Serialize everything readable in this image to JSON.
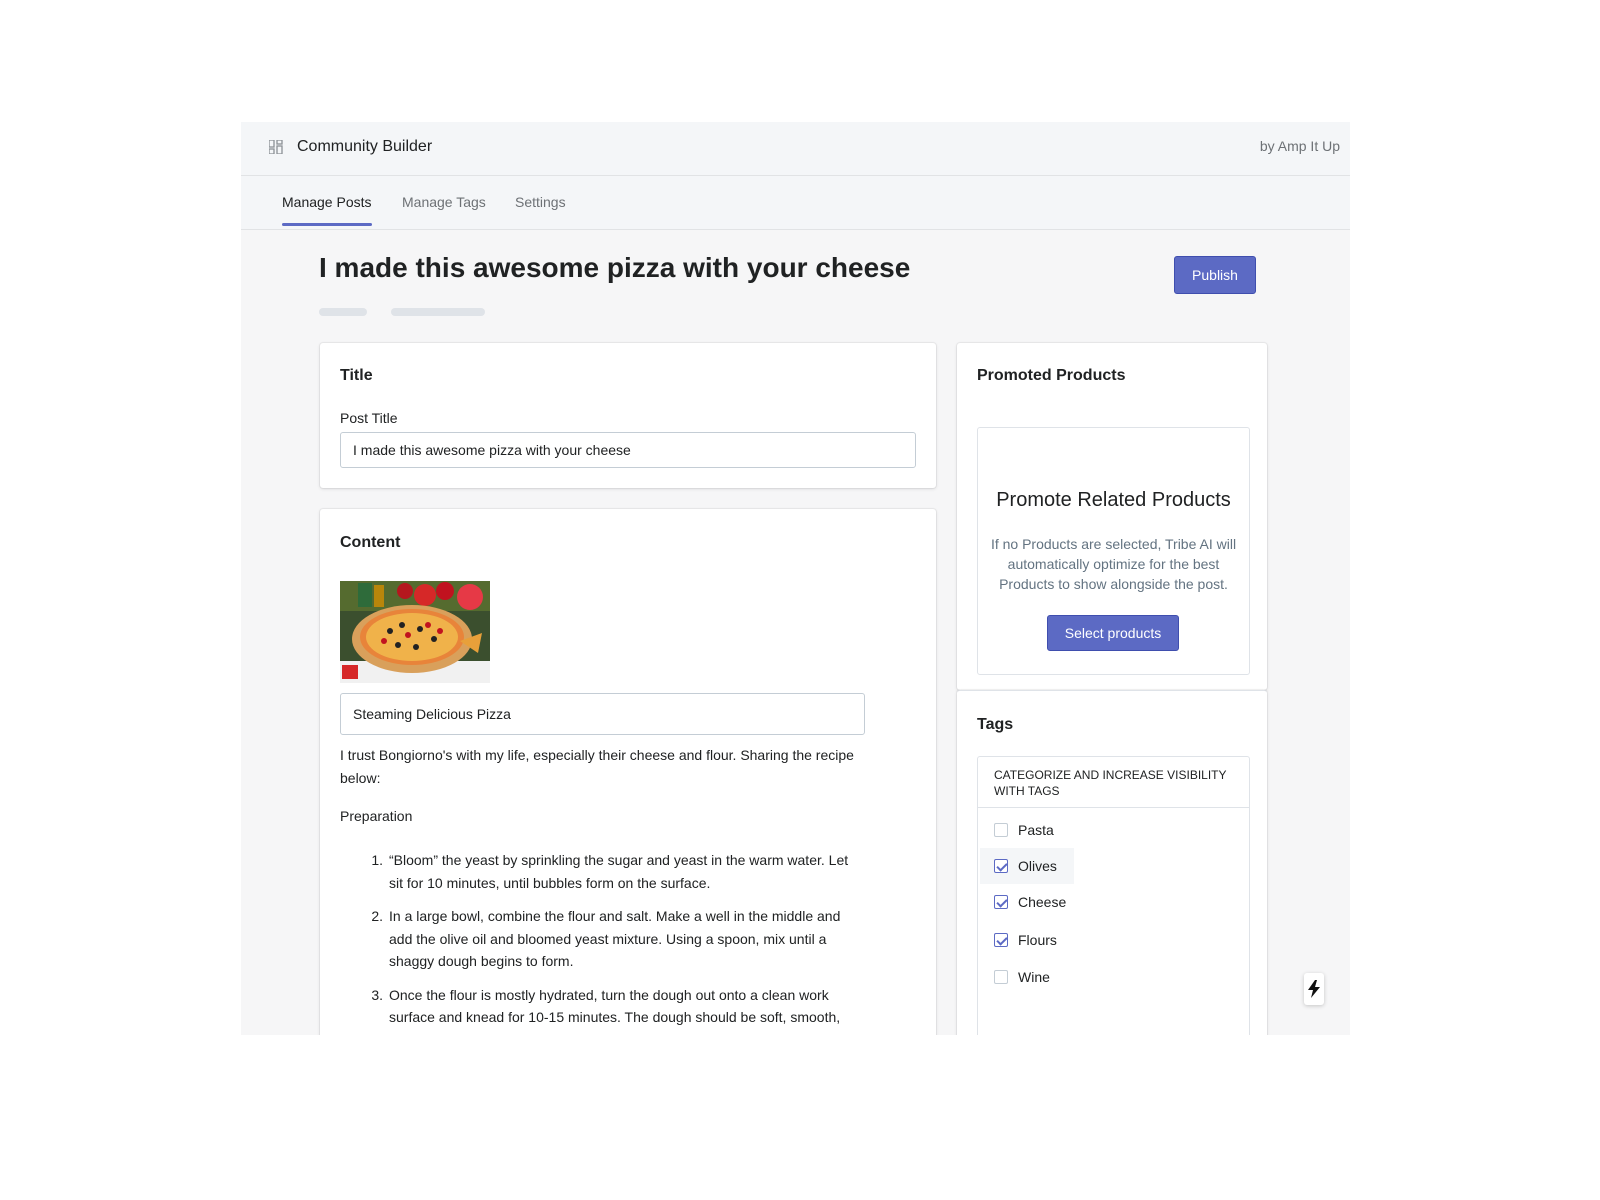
{
  "header": {
    "app_title": "Community Builder",
    "byline": "by Amp It Up"
  },
  "tabs": [
    {
      "label": "Manage Posts"
    },
    {
      "label": "Manage Tags"
    },
    {
      "label": "Settings"
    }
  ],
  "page": {
    "title": "I made this awesome pizza with your cheese",
    "publish_label": "Publish"
  },
  "title_card": {
    "heading": "Title",
    "field_label": "Post Title",
    "field_value": "I made this awesome pizza with your cheese"
  },
  "content_card": {
    "heading": "Content",
    "caption_value": "Steaming Delicious Pizza",
    "intro": "I trust Bongiorno's with my life, especially their cheese and flour. Sharing the recipe below:",
    "section": "Preparation",
    "steps": [
      {
        "num": "1.",
        "text": "“Bloom” the yeast by sprinkling the sugar and yeast in the warm water. Let sit for 10 minutes, until bubbles form on the surface."
      },
      {
        "num": "2.",
        "text": "In a large bowl, combine the flour and salt. Make a well in the middle and add the olive oil and bloomed yeast mixture. Using a spoon, mix until a shaggy dough begins to form."
      },
      {
        "num": "3.",
        "text": "Once the flour is mostly hydrated, turn the dough out onto a clean work surface and knead for 10-15 minutes. The dough should be soft, smooth, and bouncy. Form the dough into a taut round."
      }
    ]
  },
  "promoted": {
    "heading": "Promoted Products",
    "title": "Promote Related Products",
    "description": "If no Products are selected, Tribe AI will automatically optimize for the best Products to show alongside the post.",
    "button_label": "Select products"
  },
  "tags": {
    "heading": "Tags",
    "list_header": "CATEGORIZE AND INCREASE VISIBILITY WITH TAGS",
    "items": [
      {
        "label": "Pasta",
        "checked": false
      },
      {
        "label": "Olives",
        "checked": true
      },
      {
        "label": "Cheese",
        "checked": true
      },
      {
        "label": "Flours",
        "checked": true
      },
      {
        "label": "Wine",
        "checked": false
      }
    ]
  },
  "colors": {
    "accent": "#5c6ac4",
    "background": "#f6f6f7"
  },
  "icons": {
    "app": "grid-icon",
    "flash": "bolt-icon"
  }
}
